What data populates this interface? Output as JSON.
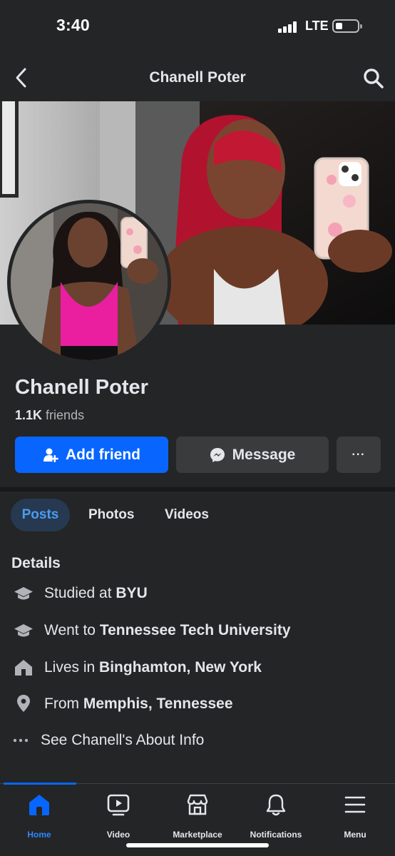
{
  "status_bar": {
    "time": "3:40",
    "network": "LTE",
    "signal_bars": 4,
    "battery_level_fraction": 0.2
  },
  "header": {
    "title": "Chanell Poter",
    "back_icon": "chevron-left-icon",
    "search_icon": "search-icon"
  },
  "profile": {
    "name": "Chanell Poter",
    "friends_count": "1.1K",
    "friends_label": "friends"
  },
  "actions": {
    "add_friend_label": "Add friend",
    "message_label": "Message",
    "more_label": "···"
  },
  "tabs": [
    {
      "label": "Posts",
      "active": true
    },
    {
      "label": "Photos",
      "active": false
    },
    {
      "label": "Videos",
      "active": false
    }
  ],
  "details": {
    "title": "Details",
    "items": [
      {
        "icon": "graduation-cap-icon",
        "prefix": "Studied at ",
        "value": "BYU"
      },
      {
        "icon": "graduation-cap-icon",
        "prefix": "Went to ",
        "value": "Tennessee Tech University"
      },
      {
        "icon": "house-icon",
        "prefix": "Lives in ",
        "value": "Binghamton, New York"
      },
      {
        "icon": "location-pin-icon",
        "prefix": "From ",
        "value": "Memphis, Tennessee"
      }
    ],
    "about_label": "See Chanell's About Info"
  },
  "bottom_nav": [
    {
      "label": "Home",
      "icon": "home-icon",
      "active": true
    },
    {
      "label": "Video",
      "icon": "video-icon",
      "active": false
    },
    {
      "label": "Marketplace",
      "icon": "marketplace-icon",
      "active": false
    },
    {
      "label": "Notifications",
      "icon": "bell-icon",
      "active": false
    },
    {
      "label": "Menu",
      "icon": "hamburger-menu-icon",
      "active": false
    }
  ],
  "colors": {
    "accent": "#0866ff",
    "background": "#242526",
    "surface": "#3a3b3c",
    "active_tab_text": "#4c9cf2"
  }
}
